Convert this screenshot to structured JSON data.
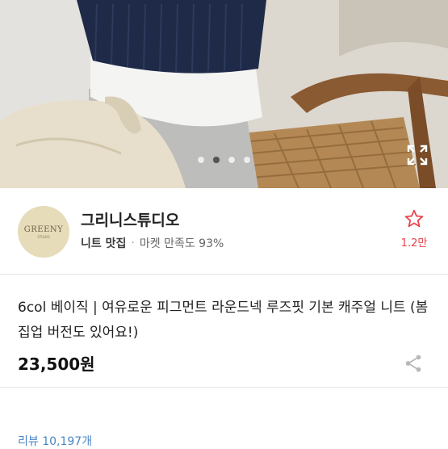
{
  "gallery": {
    "page_count": 4,
    "active_index": 1,
    "icon": "expand-icon"
  },
  "shop": {
    "logo_text": "GREENY",
    "logo_subtext": "STUDIO",
    "name": "그리니스튜디오",
    "category": "니트 맛집",
    "satisfaction": "마켓 만족도 93%",
    "favorite_icon": "star-outline-icon",
    "favorite_count": "1.2만"
  },
  "product": {
    "title": "6col 베이직 | 여유로운 피그먼트 라운드넥 루즈핏 기본 캐주얼 니트 (봄집업 버전도 있어요!)",
    "price": "23,500원",
    "share_icon": "share-icon"
  },
  "reviews": {
    "label": "리뷰 10,197개"
  },
  "colors": {
    "accent": "#e8414b",
    "link": "#4a86c5",
    "logo_bg": "#e6dcba"
  }
}
